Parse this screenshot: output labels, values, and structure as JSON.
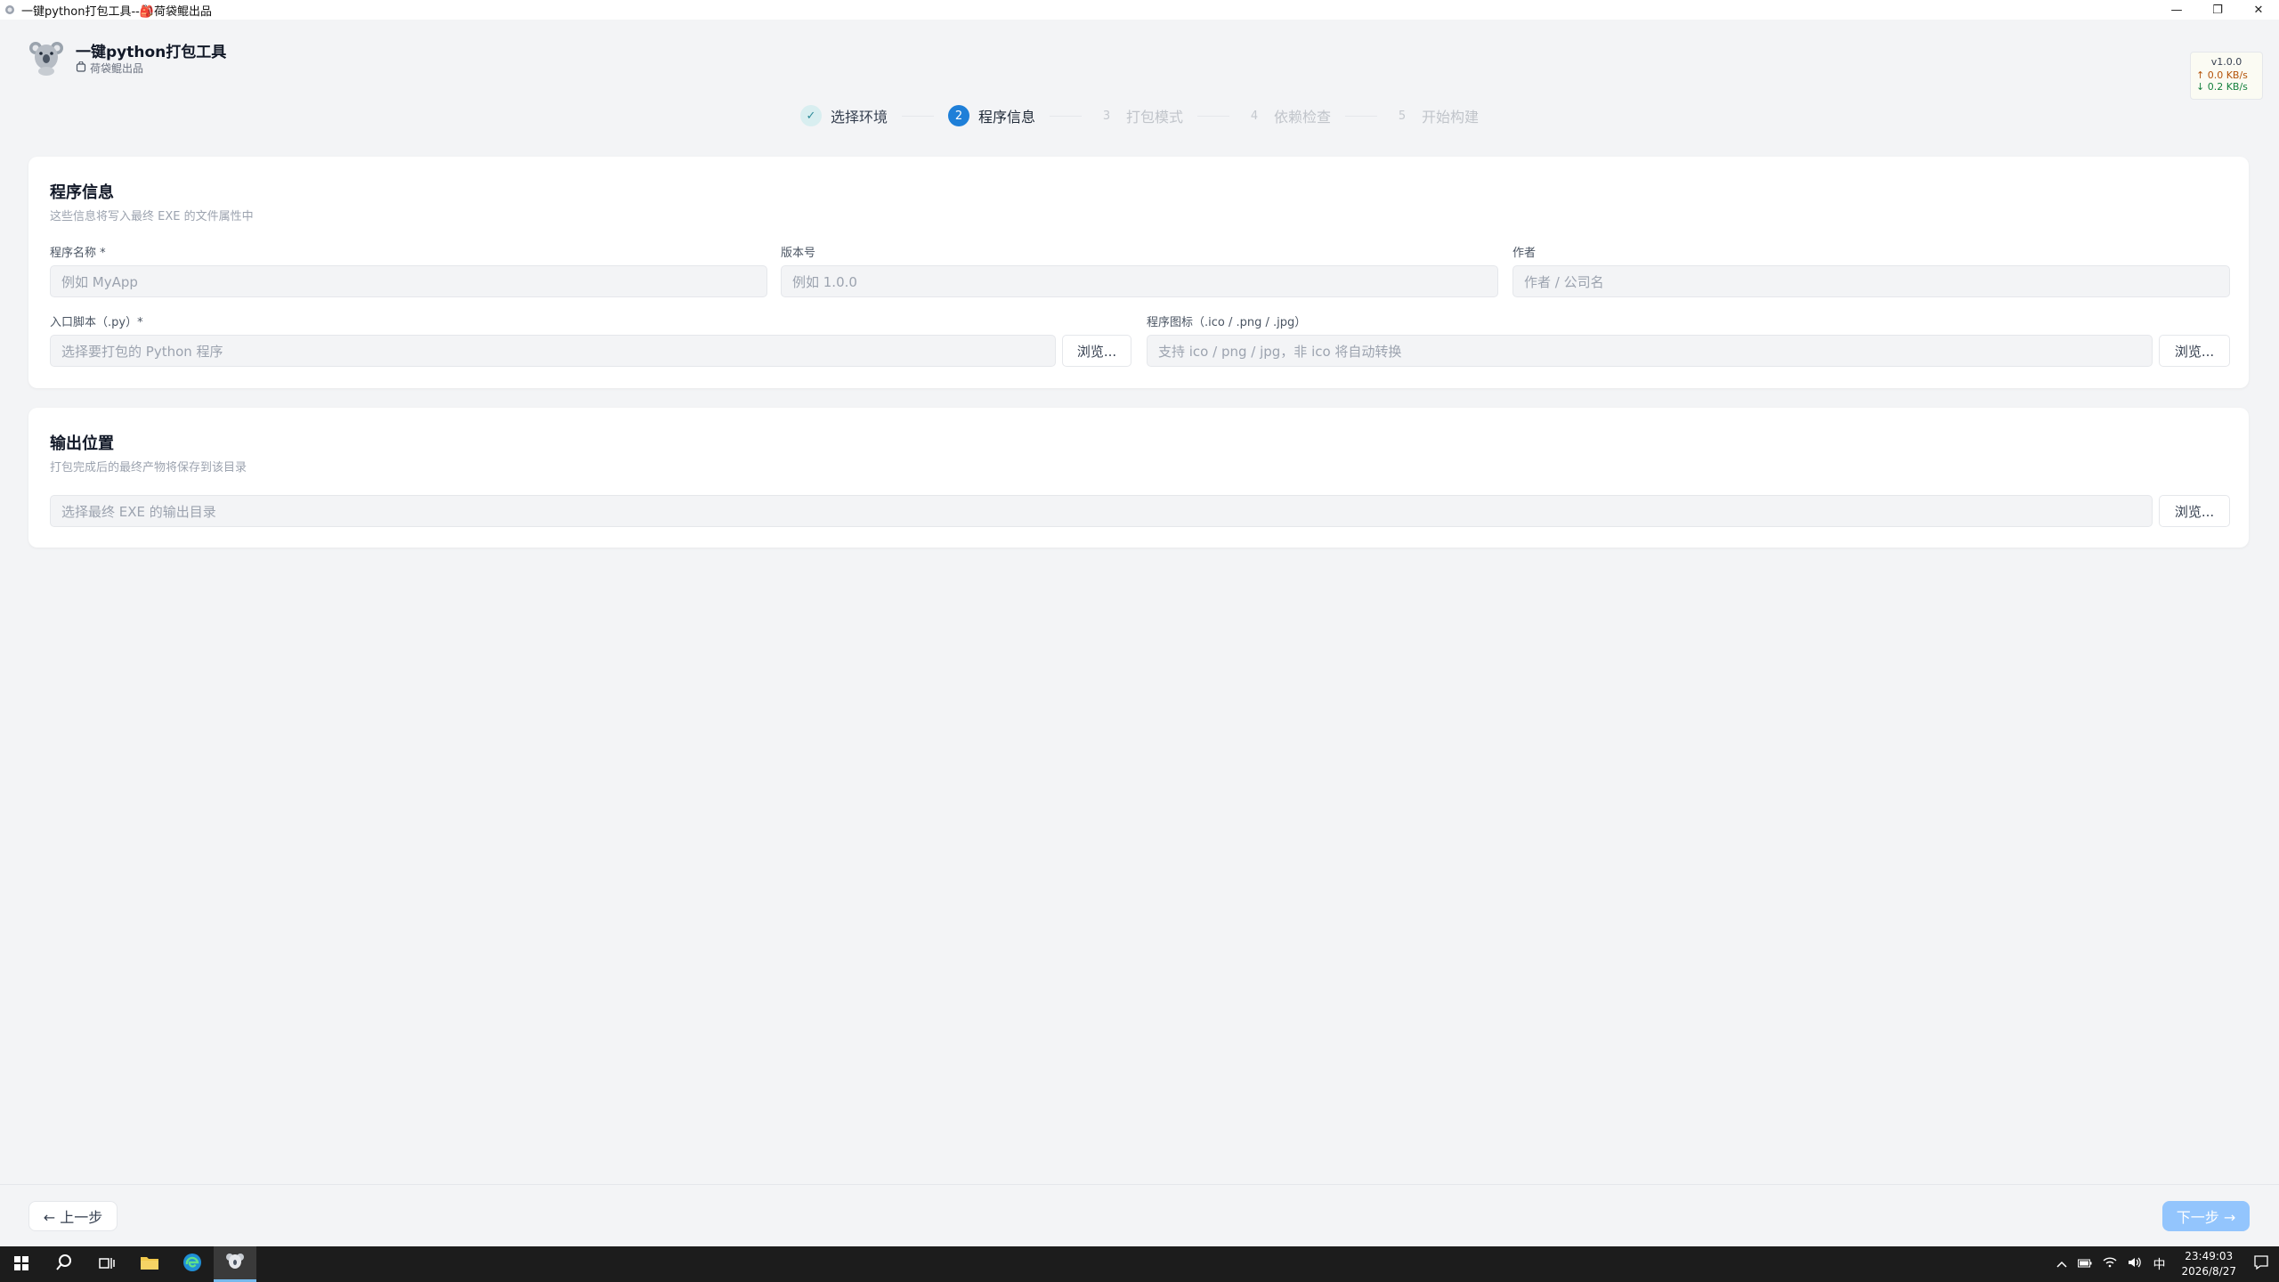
{
  "window": {
    "title": "一键python打包工具--🎒荷袋鲲出品",
    "min_glyph": "—",
    "restore_glyph": "❐",
    "close_glyph": "✕"
  },
  "app": {
    "name": "一键python打包工具",
    "subtitle": "荷袋鲲出品",
    "version": "v1.0.0",
    "net_up": "↑ 0.0 KB/s",
    "net_down": "↓ 0.2 KB/s"
  },
  "steps": [
    {
      "marker": "✓",
      "label": "选择环境",
      "state": "done"
    },
    {
      "marker": "2",
      "label": "程序信息",
      "state": "active"
    },
    {
      "marker": "3",
      "label": "打包模式",
      "state": "pending"
    },
    {
      "marker": "4",
      "label": "依赖检查",
      "state": "pending"
    },
    {
      "marker": "5",
      "label": "开始构建",
      "state": "pending"
    }
  ],
  "program_info": {
    "title": "程序信息",
    "desc": "这些信息将写入最终 EXE 的文件属性中",
    "name_label": "程序名称 *",
    "name_placeholder": "例如 MyApp",
    "version_label": "版本号",
    "version_placeholder": "例如 1.0.0",
    "author_label": "作者",
    "author_placeholder": "作者 / 公司名",
    "entry_label": "入口脚本（.py）*",
    "entry_placeholder": "选择要打包的 Python 程序",
    "icon_label": "程序图标（.ico / .png / .jpg）",
    "icon_placeholder": "支持 ico / png / jpg，非 ico 将自动转换",
    "browse": "浏览..."
  },
  "output": {
    "title": "输出位置",
    "desc": "打包完成后的最终产物将保存到该目录",
    "dir_placeholder": "选择最终 EXE 的输出目录",
    "browse": "浏览..."
  },
  "nav": {
    "prev": "← 上一步",
    "next": "下一步 →"
  },
  "taskbar": {
    "time": "23:49:03",
    "date": "2026/8/27",
    "ime": "中"
  },
  "colors": {
    "accent": "#1e7fd8",
    "next_disabled": "#93c5fd",
    "done_step": "#2e8b99"
  }
}
